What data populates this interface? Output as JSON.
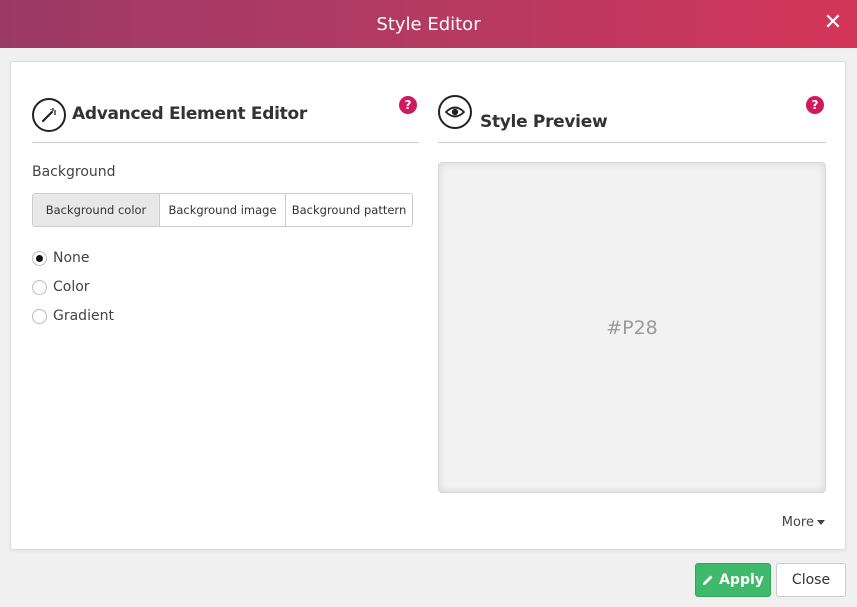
{
  "window": {
    "title": "Style Editor",
    "close_icon": "close-icon"
  },
  "editor": {
    "title": "Advanced Element Editor",
    "icon": "magic-wand-icon",
    "help": "?",
    "background_label": "Background",
    "tabs": [
      {
        "label": "Background color",
        "active": true
      },
      {
        "label": "Background image",
        "active": false
      },
      {
        "label": "Background pattern",
        "active": false
      }
    ],
    "options": [
      {
        "label": "None",
        "checked": true
      },
      {
        "label": "Color",
        "checked": false
      },
      {
        "label": "Gradient",
        "checked": false
      }
    ]
  },
  "preview": {
    "title": "Style Preview",
    "icon": "eye-icon",
    "help": "?",
    "element_id": "#P28",
    "more_label": "More"
  },
  "footer": {
    "apply_label": "Apply",
    "close_label": "Close"
  },
  "colors": {
    "header_start": "#9c3a66",
    "header_end": "#d33559",
    "help": "#d1195e",
    "apply": "#3fb96b"
  }
}
